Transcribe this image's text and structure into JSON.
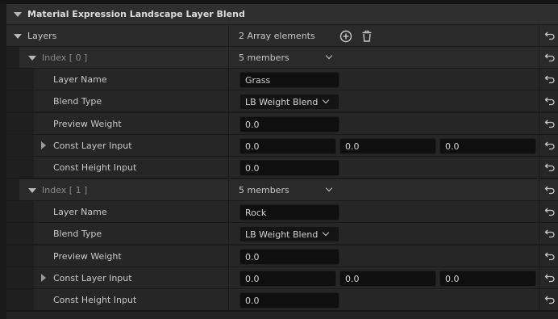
{
  "category": {
    "title": "Material Expression Landscape Layer Blend"
  },
  "layers": {
    "label": "Layers",
    "value": "2 Array elements",
    "add_icon": "plus-circle-icon",
    "delete_icon": "trash-icon"
  },
  "items": [
    {
      "index_label": "Index [ 0 ]",
      "members": "5 members",
      "layer_name_label": "Layer Name",
      "layer_name": "Grass",
      "blend_type_label": "Blend Type",
      "blend_type": "LB Weight Blend",
      "preview_weight_label": "Preview Weight",
      "preview_weight": "0.0",
      "const_layer_label": "Const Layer Input",
      "const_layer": [
        "0.0",
        "0.0",
        "0.0"
      ],
      "const_height_label": "Const Height Input",
      "const_height": "0.0"
    },
    {
      "index_label": "Index [ 1 ]",
      "members": "5 members",
      "layer_name_label": "Layer Name",
      "layer_name": "Rock",
      "blend_type_label": "Blend Type",
      "blend_type": "LB Weight Blend",
      "preview_weight_label": "Preview Weight",
      "preview_weight": "0.0",
      "const_layer_label": "Const Layer Input",
      "const_layer": [
        "0.0",
        "0.0",
        "0.0"
      ],
      "const_height_label": "Const Height Input",
      "const_height": "0.0"
    }
  ],
  "colors": {
    "panel": "#262626",
    "field": "#0f0f0f",
    "text": "#c8c8c8"
  }
}
